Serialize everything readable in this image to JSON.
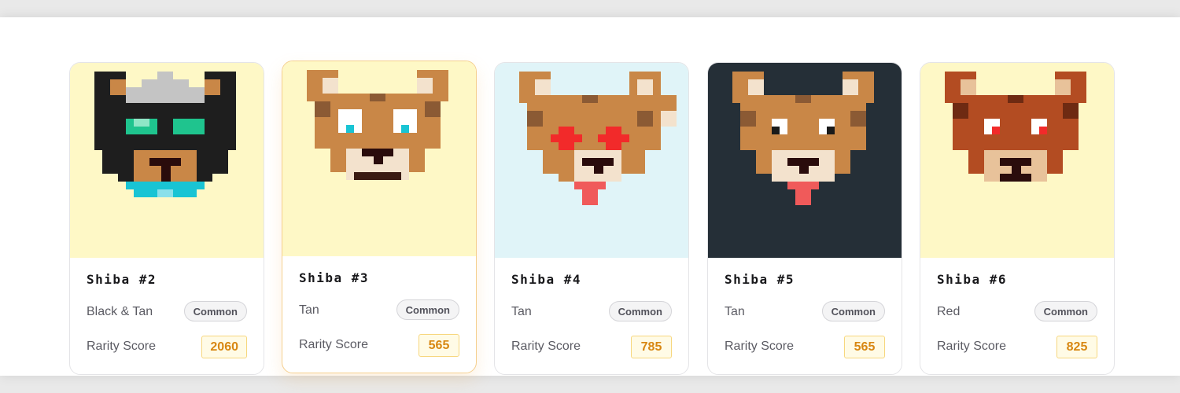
{
  "cards": [
    {
      "id": "shiba-2",
      "title": "Shiba #2",
      "color": "Black & Tan",
      "rarity": "Common",
      "score_label": "Rarity Score",
      "score": "2060",
      "bg": "#fef8c6",
      "avatar": "black-tan-shiba-with-helmet-and-goggles"
    },
    {
      "id": "shiba-3",
      "title": "Shiba #3",
      "color": "Tan",
      "rarity": "Common",
      "score_label": "Rarity Score",
      "score": "565",
      "bg": "#fef8c6",
      "avatar": "tan-shiba",
      "active": true
    },
    {
      "id": "shiba-4",
      "title": "Shiba #4",
      "color": "Tan",
      "rarity": "Common",
      "score_label": "Rarity Score",
      "score": "785",
      "bg": "#e0f4f8",
      "avatar": "tan-shiba-with-red-cross-eyes-and-tongue"
    },
    {
      "id": "shiba-5",
      "title": "Shiba #5",
      "color": "Tan",
      "rarity": "Common",
      "score_label": "Rarity Score",
      "score": "565",
      "bg": "#252f37",
      "avatar": "tan-shiba-with-tongue"
    },
    {
      "id": "shiba-6",
      "title": "Shiba #6",
      "color": "Red",
      "rarity": "Common",
      "score_label": "Rarity Score",
      "score": "825",
      "bg": "#fef8c6",
      "avatar": "red-shiba"
    }
  ]
}
